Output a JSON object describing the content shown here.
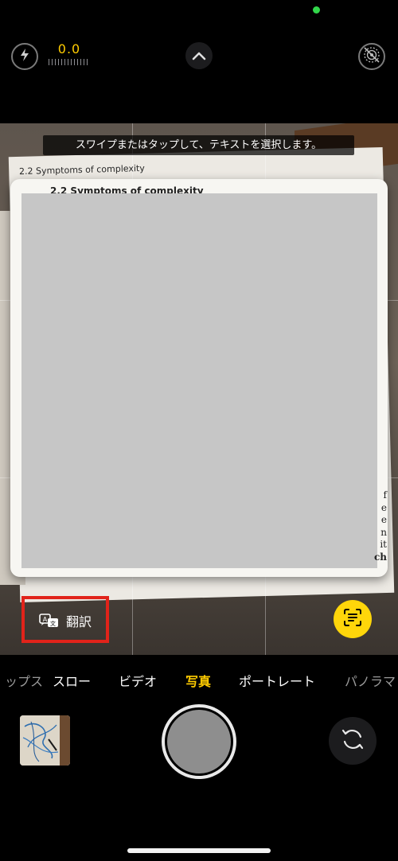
{
  "camera": {
    "exposure_value": "0.0",
    "hint": "スワイプまたはタップして、テキストを選択します。",
    "background_heading": "2.2   Symptoms of complexity",
    "card_heading": "2.2   Symptoms of complexity",
    "edge_letters": [
      "f",
      "e",
      "e",
      "n",
      "it",
      "ch"
    ],
    "translate_label": "翻訳"
  },
  "modes": {
    "items": [
      {
        "label": "ップス"
      },
      {
        "label": "スロー"
      },
      {
        "label": "ビデオ"
      },
      {
        "label": "写真"
      },
      {
        "label": "ポートレート"
      },
      {
        "label": "パノラマ"
      }
    ],
    "selected": "写真"
  },
  "icons": {
    "flash": "flash-off-icon",
    "chevron": "chevron-up-icon",
    "live_photo": "live-photo-off-icon",
    "translate": "translate-icon",
    "live_text": "live-text-icon",
    "flip": "camera-flip-icon"
  },
  "colors": {
    "accent": "#ffcc00",
    "live_text_button": "#ffd60a",
    "highlight": "#e1231a",
    "status_dot": "#32d74b"
  }
}
